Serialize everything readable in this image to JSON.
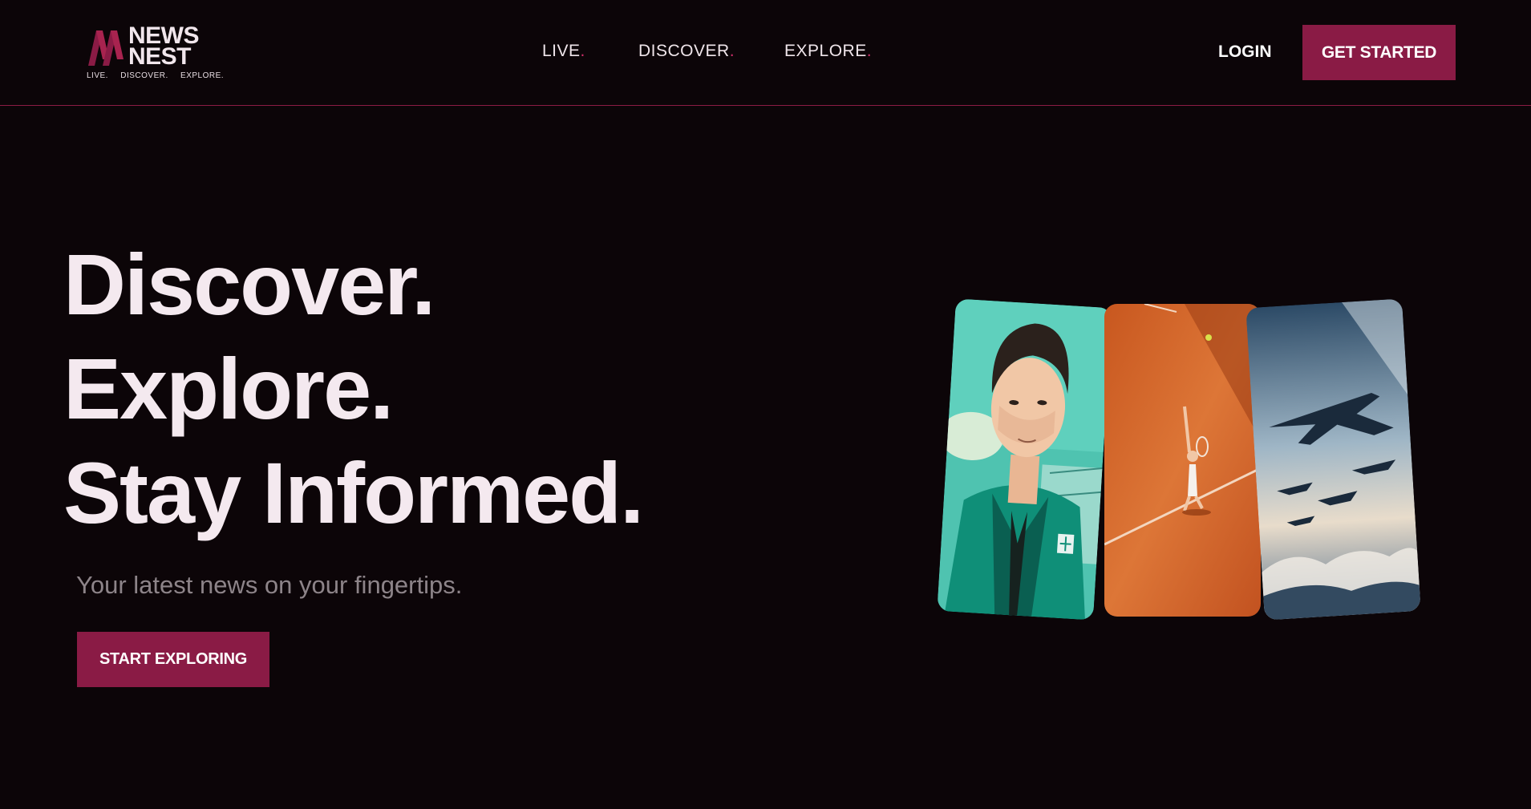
{
  "header": {
    "logo": {
      "word_line1": "NEWS",
      "word_line2": "NEST",
      "tagline": [
        "LIVE.",
        "DISCOVER.",
        "EXPLORE."
      ],
      "mark_icon": "nn-monogram-icon"
    },
    "nav": [
      {
        "label": "LIVE",
        "dot": "."
      },
      {
        "label": "DISCOVER",
        "dot": "."
      },
      {
        "label": "EXPLORE",
        "dot": "."
      }
    ],
    "login_label": "LOGIN",
    "get_started_label": "GET STARTED"
  },
  "hero": {
    "title_lines": [
      "Discover.",
      "Explore.",
      "Stay Informed."
    ],
    "subtitle": "Your latest news on your fingertips.",
    "cta_label": "START EXPLORING"
  },
  "cards": [
    {
      "image": "portrait-illustration"
    },
    {
      "image": "tennis-clay-court-illustration"
    },
    {
      "image": "fighter-jets-sky-illustration"
    }
  ],
  "colors": {
    "background": "#0c0508",
    "accent": "#8a1b45",
    "nav_dot": "#d02e6a",
    "text": "#f4e9ef",
    "muted": "#8d8489"
  }
}
